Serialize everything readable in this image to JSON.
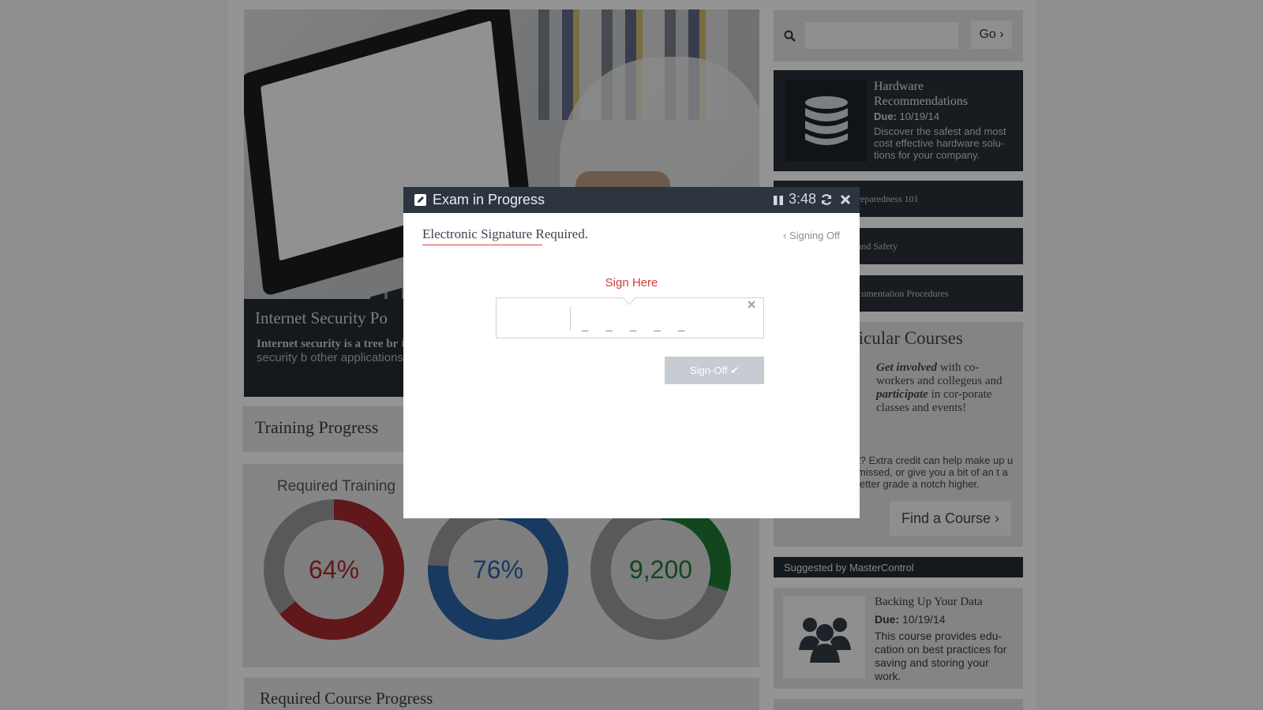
{
  "hero": {
    "title": "Internet Security Po",
    "text_bold": "Internet security is a tree br",
    "text_rest": "involving browser security b other applications or operat"
  },
  "training": {
    "title": "Training Progress",
    "required_label": "Required Training",
    "gauges": [
      {
        "value_text": "64%",
        "fraction": 0.64,
        "color": "#a72a2f"
      },
      {
        "value_text": "76%",
        "fraction": 0.76,
        "color": "#2a64a8"
      },
      {
        "value_text": "9,200",
        "fraction": 0.3,
        "color": "#1f7a34"
      }
    ]
  },
  "required_course": {
    "title": "Required Course Progress"
  },
  "search": {
    "placeholder": "",
    "go_label": "Go",
    "go_icon": "chevron-right-icon"
  },
  "hardware_card": {
    "title": "Hardware Recommendations",
    "due_label": "Due:",
    "due_date": "10/19/14",
    "description": "Discover the safest and most cost effective hardware solu-tions for your company.",
    "icon": "database-icon"
  },
  "dark_items": [
    {
      "label": "reparedness 101"
    },
    {
      "label": "and Safety"
    },
    {
      "label": "cumentation Procedures"
    }
  ],
  "extra": {
    "title": "ricular Courses",
    "text_1a": "Get involved",
    "text_1b": "with co-workers and collegeus and",
    "text_1c": "participate",
    "text_1d": "in cor-porate classes and events!",
    "text_2": "t? Extra credit can help make up u missed, or give you a bit of an t a letter grade a notch higher.",
    "find_label": "Find a Course"
  },
  "suggested": {
    "label": "Suggested by MasterControl"
  },
  "backing_card": {
    "title": "Backing Up Your Data",
    "due_label": "Due:",
    "due_date": "10/19/14",
    "description": "This course provides edu-cation on best practices for saving and storing your work.",
    "icon": "users-icon"
  },
  "modal": {
    "title": "Exam in Progress",
    "timer": "3:48",
    "signature_title_a": "Electronic Signature",
    "signature_title_b": "Required.",
    "back_label": "Signing Off",
    "sign_here": "Sign Here",
    "sig_dashes": "_ _ _ _ _",
    "signoff_label": "Sign-Off",
    "colors": {
      "header": "#2c353f",
      "accent": "#d13b3b",
      "button": "#c7ccd2"
    }
  }
}
